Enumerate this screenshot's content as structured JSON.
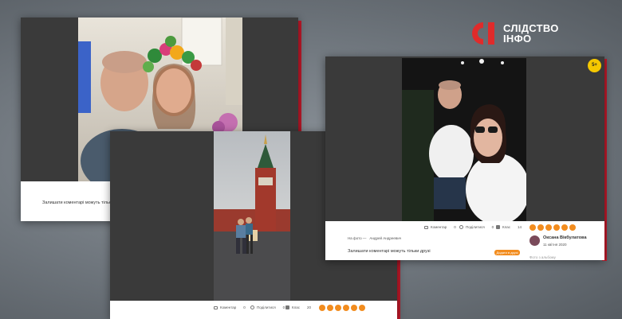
{
  "brand": {
    "name_line1": "СЛІДСТВО",
    "name_line2": "ІНФО",
    "colors": {
      "red": "#e02b2b",
      "white": "#ffffff"
    }
  },
  "post_left": {
    "comment_notice": "Залишати коментарі можуть тільки друзі"
  },
  "post_center": {
    "actions": [
      {
        "label": "Коментар",
        "count": "0"
      },
      {
        "label": "Поділитися",
        "count": "0"
      },
      {
        "label": "Клас",
        "count": "20"
      }
    ]
  },
  "post_right": {
    "age_badge": "5+",
    "photo_tag_prefix": "На фото —",
    "photo_tag_person": "Андрей Андреевич",
    "comment_notice": "Залишати коментарі можуть тільки друзі",
    "add_friend_label": "Додати в друзі",
    "author_name": "Оксана Вікбулатова",
    "author_date": "11 квітня 2020",
    "album_link": "Фото з альбому",
    "actions": [
      {
        "label": "Коментар",
        "count": "0"
      },
      {
        "label": "Поділитися",
        "count": "0"
      },
      {
        "label": "Клас",
        "count": "14"
      }
    ]
  }
}
